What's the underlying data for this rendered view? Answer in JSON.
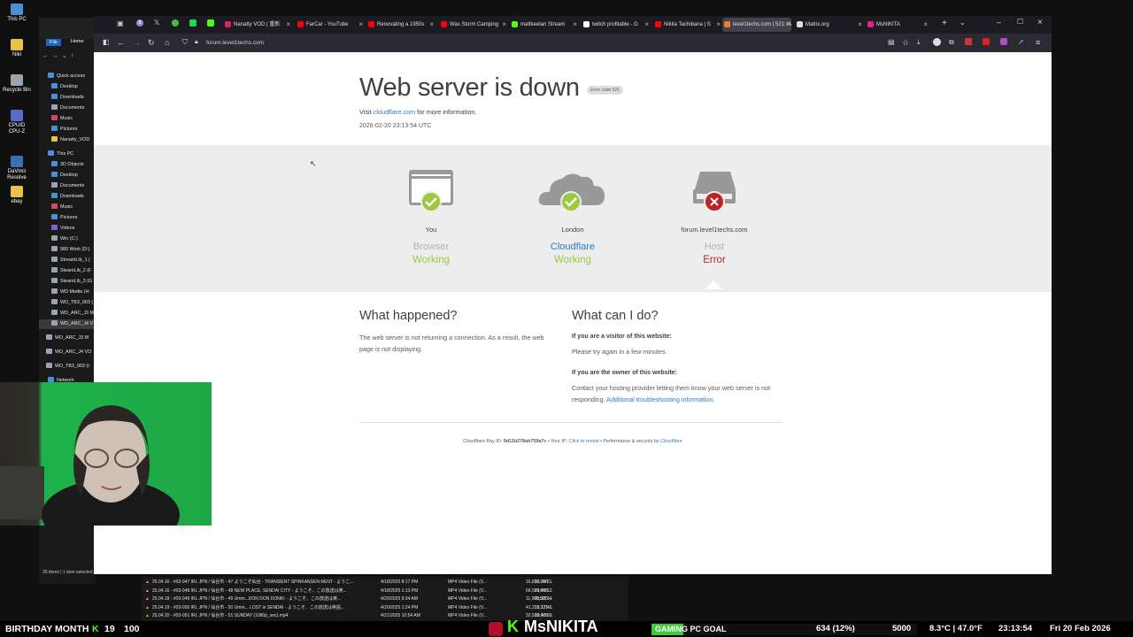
{
  "desktop": {
    "icons": [
      {
        "label": "This PC",
        "color": "#4a90d9"
      },
      {
        "label": "Niki",
        "color": "#e8c34a"
      },
      {
        "label": "Recycle Bin",
        "color": "#9aa4b0"
      },
      {
        "label": "CPUID CPU-Z",
        "color": "#5a6cc8"
      },
      {
        "label": "DaVinci Resolve",
        "color": "#3d6fb5"
      },
      {
        "label": "ebay",
        "color": "#e8c34a"
      }
    ]
  },
  "explorer": {
    "file_tab": "File",
    "home_tab": "Home",
    "items": [
      "Quick access",
      "Desktop",
      "Downloads",
      "Documents",
      "Music",
      "Pictures",
      "Nanatty_VOD",
      "This PC",
      "3D Objects",
      "Desktop",
      "Documents",
      "Downloads",
      "Music",
      "Pictures",
      "Videos",
      "Win (C:)",
      "980 Work (D:)",
      "StreamLib_1 (",
      "SteamLib_2 (F",
      "SteamLib_3 (G",
      "WD Media (H:",
      "WD_TB3_003 (",
      "WD_ARC_J3 M",
      "WD_ARC_J4 V",
      "WD_ARC_J3 M",
      "WD_ARC_J4 VO",
      "WD_TB3_003 (I:",
      "Network"
    ],
    "status": "30 items | 1 item selected  0.8 MB"
  },
  "browser": {
    "tabs": [
      {
        "label": "Nanatty VOD | 重新",
        "color": "#e0245e"
      },
      {
        "label": "FarCar - YouTube",
        "color": "#ff0000"
      },
      {
        "label": "Renovating a 1950s",
        "color": "#ff0000"
      },
      {
        "label": "Was Storm Camping",
        "color": "#ff0000"
      },
      {
        "label": "mattkeelan Stream",
        "color": "#53fc18"
      },
      {
        "label": "twitch profitable - G",
        "color": "#ffffff"
      },
      {
        "label": "Nikita Tachibana | S",
        "color": "#ff0000"
      },
      {
        "label": "level1techs.com | 521: W",
        "color": "#f38020"
      },
      {
        "label": "Matrix.org",
        "color": "#dddddd"
      },
      {
        "label": "MsNIKITA",
        "color": "#e91e8c"
      }
    ],
    "url": "forum.level1techs.com"
  },
  "page": {
    "title": "Web server is down",
    "error_code": "Error code 521",
    "visit_prefix": "Visit",
    "visit_link": "cloudflare.com",
    "visit_suffix": "for more information.",
    "timestamp": "2026-02-20 23:13:54 UTC",
    "columns": [
      {
        "label": "You",
        "name": "Browser",
        "status": "Working",
        "state": "ok"
      },
      {
        "label": "London",
        "name": "Cloudflare",
        "status": "Working",
        "state": "ok"
      },
      {
        "label": "forum.level1techs.com",
        "name": "Host",
        "status": "Error",
        "state": "error"
      }
    ],
    "what_happened_title": "What happened?",
    "what_happened_text": "The web server is not returning a connection. As a result, the web page is not displaying.",
    "what_can_i_do_title": "What can I do?",
    "visitor_heading": "If you are a visitor of this website:",
    "visitor_text": "Please try again in a few minutes.",
    "owner_heading": "If you are the owner of this website:",
    "owner_text": "Contact your hosting provider letting them know your web server is not responding.",
    "owner_link": "Additional troubleshooting information.",
    "footer": {
      "ray_label": "Cloudflare Ray ID:",
      "ray_id": "9d11b278ab759a7c",
      "ip_label": "• Your IP:",
      "ip_link": "Click to reveal",
      "perf_label": "• Performance & security by",
      "perf_link": "Cloudflare"
    }
  },
  "file_list": [
    {
      "name": "25.04.16 - #03-047 IRL JPN / 仙台市 - 47 ようこそ仙台 - TRANSIENT SPINKANSEN RENT - ようこ...",
      "date": "4/18/2025 8:17 PM",
      "type": "MP4 Video File (V...",
      "size": "16,810,160 ...",
      "len": "03:39:51"
    },
    {
      "name": "25.04.16 - #03-048 IRL JPN / 仙台市 - 48 NEW PLACE, SENDAI CITY - ようこそ、この放送は英...",
      "date": "4/18/2025 1:13 PM",
      "type": "MP4 Video File (V...",
      "size": "66,599,066 ...",
      "len": "01:49:12"
    },
    {
      "name": "25.04.18 - #03-049 IRL JPN / 仙台市 - 49 Umm...DON DON DONKI - ようこそ、この放送は英...",
      "date": "4/20/2025 9:34 AM",
      "type": "MP4 Video File (V...",
      "size": "11,905,500 ...",
      "len": "03:32:34"
    },
    {
      "name": "25.04.19 - #03-050 IRL JPN / 仙台市 - 50 Umm... LOST in SENDAI - ようこそ、この放送は英語...",
      "date": "4/20/2025 1:24 PM",
      "type": "MP4 Video File (V...",
      "size": "41,315,721 ...",
      "len": "12:17:46"
    },
    {
      "name": "25.04.20 - #03-051 IRL JPN / 仙台市 - 51 SUNDAY  (1080p_sec).mp4",
      "date": "4/21/2025 10:54 AM",
      "type": "MP4 Video File (V...",
      "size": "32,513,109 ...",
      "len": "09:40:39"
    }
  ],
  "stream_bar": {
    "birthday": "BIRTHDAY MONTH",
    "n1": "19",
    "n2": "100",
    "channel": "MsNIKITA",
    "goal_label": "GAMING PC GOAL",
    "goal_progress": "634 (12%)",
    "goal_fraction": 0.12,
    "goal_target": "5000",
    "temp": "8.3°C | 47.0°F",
    "time": "23:13:54",
    "date": "Fri 20 Feb 2026"
  }
}
